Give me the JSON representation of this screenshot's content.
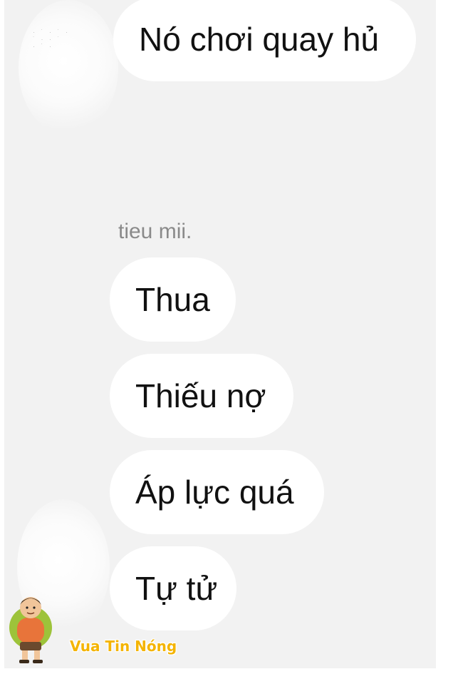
{
  "conversation": {
    "sender_name": "tieu mii.",
    "top_message": "Nó chơi quay hủ",
    "messages": [
      "Thua",
      "Thiếu nợ",
      "Áp lực quá",
      "Tự tử"
    ]
  },
  "watermark": {
    "text": "Vua Tin Nóng",
    "icon": "cartoon-mascot"
  },
  "colors": {
    "background": "#f2f2f2",
    "bubble": "#ffffff",
    "message_text": "#111111",
    "sender_text": "#8a8a8a",
    "watermark_text": "#f4b400"
  }
}
